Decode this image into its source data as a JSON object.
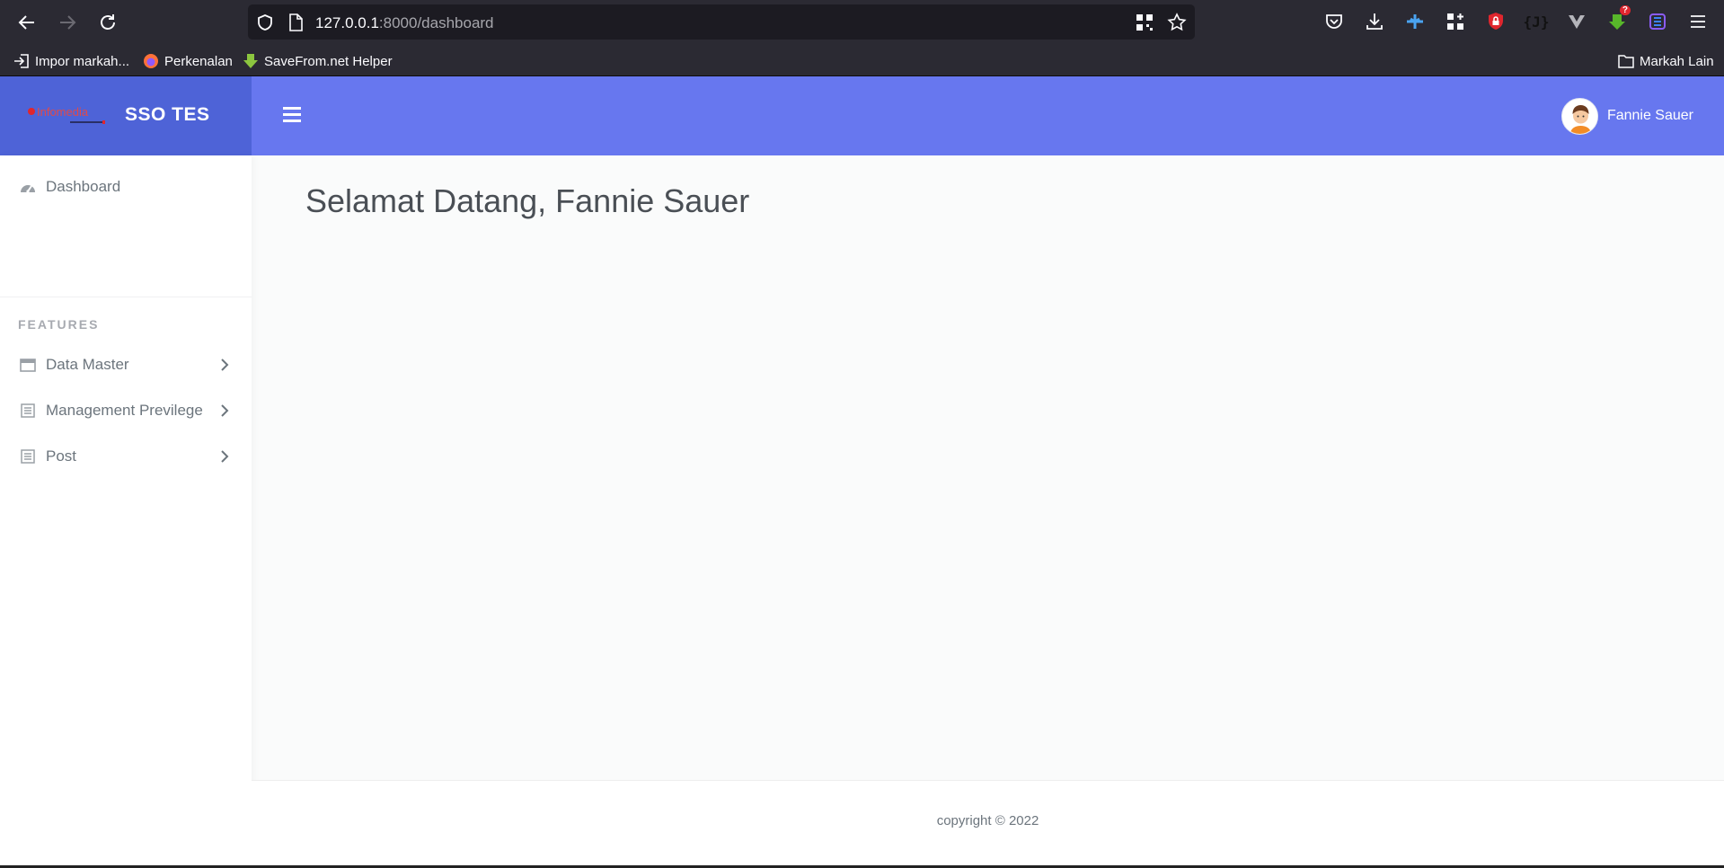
{
  "browser": {
    "url_host": "127.0.0.1",
    "url_rest": ":8000/dashboard",
    "bookmarks": [
      {
        "label": "Impor markah..."
      },
      {
        "label": "Perkenalan"
      },
      {
        "label": "SaveFrom.net Helper"
      }
    ],
    "other_bookmarks": "Markah Lain",
    "extensions": {
      "json_viewer_label": "{J}",
      "badge_count": "?"
    }
  },
  "app": {
    "brand_title": "SSO TES",
    "logo_text": "Infomedia"
  },
  "header": {
    "user_name": "Fannie Sauer"
  },
  "sidebar": {
    "dashboard_label": "Dashboard",
    "section_header": "FEATURES",
    "items": [
      {
        "label": "Data Master"
      },
      {
        "label": "Management Previlege"
      },
      {
        "label": "Post"
      }
    ]
  },
  "main": {
    "welcome": "Selamat Datang, Fannie Sauer"
  },
  "footer": {
    "copyright": "copyright © 2022"
  },
  "colors": {
    "brand_bg": "#4e63d7",
    "topbar_bg": "#6777ef",
    "page_bg": "#fafbfb"
  }
}
